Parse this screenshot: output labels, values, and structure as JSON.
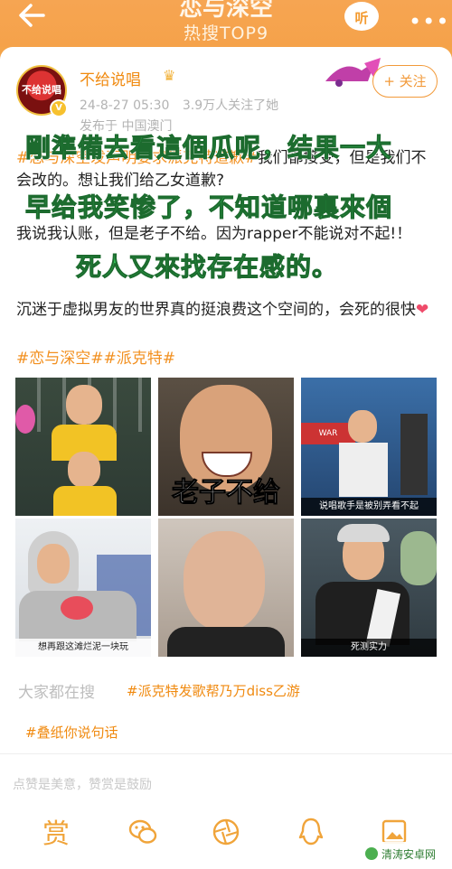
{
  "header": {
    "title": "恋与深空",
    "subtitle": "热搜TOP9",
    "listen_label": "听"
  },
  "post": {
    "author": "不给说唱",
    "date": "24-8-27 05:30",
    "followers": "3.9万人关注了她",
    "location": "发布于 中国澳门",
    "follow_button": "+ 关注",
    "avatar_text": "不给说唱"
  },
  "body": {
    "p1_tag": "#恋与深空发声明要求派克特道歉#",
    "p1_text": "我们都接受，但是我们不会改的。想让我们给乙女道歉?",
    "p2": "我说我认账，但是老子不给。因为rapper不能说对不起!！",
    "p3": "沉迷于虚拟男友的世界真的挺浪费这个空间的，会死的很快",
    "heart": "❤",
    "tags": [
      "#恋与深空#",
      "#派克特#"
    ]
  },
  "overlay": {
    "line1": "剛準備去看這個瓜呢，结果一大",
    "line2": "早给我笑惨了，不知道哪裏來個",
    "line3": "死人又來找存在感的。"
  },
  "images": [
    {
      "caption": "",
      "big_text": ""
    },
    {
      "caption": "",
      "big_text": "老子不给"
    },
    {
      "caption": "说唱歌手是被别弄看不起",
      "big_text": ""
    },
    {
      "caption": "想再跟这滩烂泥一块玩",
      "big_text": ""
    },
    {
      "caption": "",
      "big_text": ""
    },
    {
      "caption": "死测实力",
      "big_text": ""
    }
  ],
  "search": {
    "label": "大家都在搜",
    "chips": [
      "#派克特发歌帮乃万diss乙游",
      "#叠纸你说句话"
    ]
  },
  "footer": {
    "hint": "点赞是美意，赞赏是鼓励",
    "reward": "赏",
    "watermark": "清涛安卓网"
  },
  "colors": {
    "accent": "#f29a3a",
    "header": "#f5a24a",
    "overlay": "#34c45a"
  }
}
